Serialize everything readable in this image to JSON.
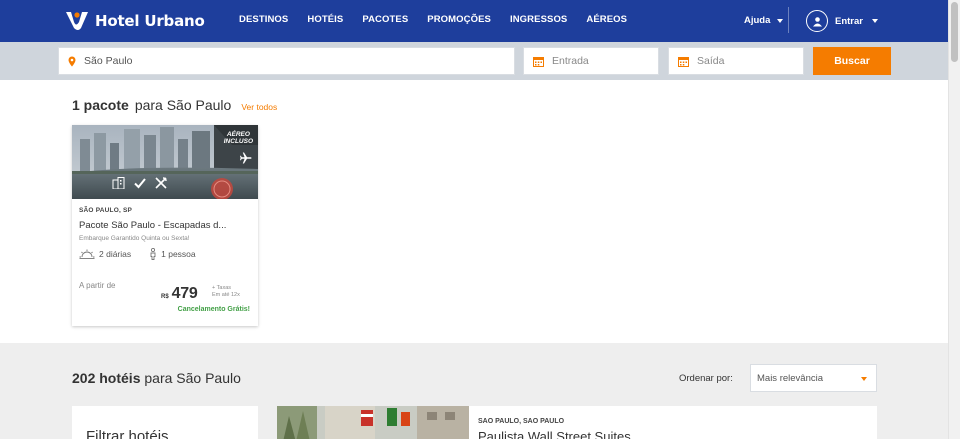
{
  "header": {
    "brand": "Hotel Urbano",
    "nav": [
      "DESTINOS",
      "HOTÉIS",
      "PACOTES",
      "PROMOÇÕES",
      "INGRESSOS",
      "AÉREOS"
    ],
    "help": "Ajuda",
    "login": "Entrar",
    "bg_color": "#1e3e9c"
  },
  "search": {
    "destination": "São Paulo",
    "checkin_placeholder": "Entrada",
    "checkout_placeholder": "Saída",
    "button": "Buscar",
    "accent_color": "#f57c00"
  },
  "packages": {
    "count": "1 pacote",
    "for": "para São Paulo",
    "see_all": "Ver todos",
    "card": {
      "badge_line1": "AÉREO",
      "badge_line2": "INCLUSO",
      "location": "SÃO PAULO, SP",
      "name": "Pacote São Paulo - Escapadas d...",
      "subtitle": "Embarque Garantido Quinta ou Sexta!",
      "nights": "2 diárias",
      "people": "1 pessoa",
      "from": "A partir de",
      "currency": "R$",
      "price": "479",
      "taxes": "+ Taxas",
      "installments": "Em até 12x",
      "cancellation": "Cancelamento Grátis!",
      "amenity_icons": [
        "building-icon",
        "check-icon",
        "utensils-icon"
      ]
    }
  },
  "hotels": {
    "count": "202 hotéis",
    "for": "para São Paulo",
    "sort_label": "Ordenar por:",
    "sort_value": "Mais relevância",
    "filter_title": "Filtrar hotéis",
    "first": {
      "location": "SAO PAULO, SAO PAULO",
      "name": "Paulista Wall Street Suites"
    }
  }
}
